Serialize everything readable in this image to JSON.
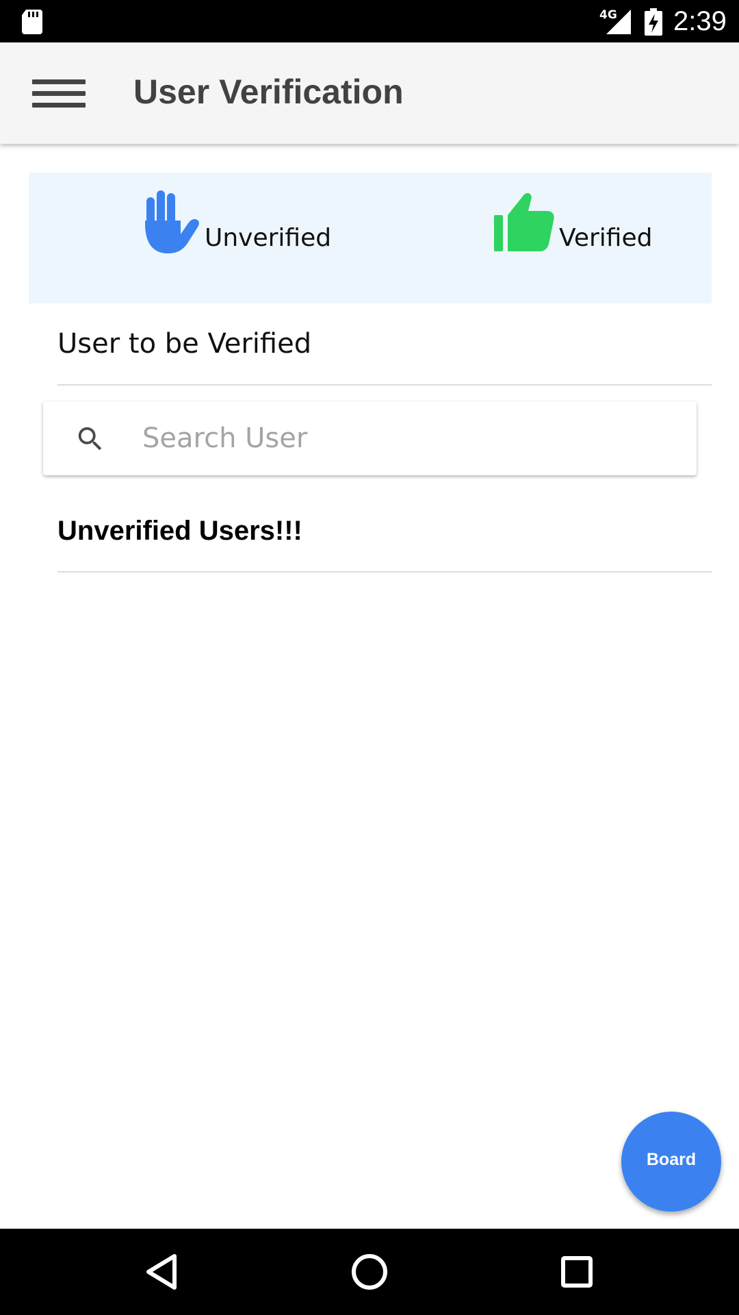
{
  "status_bar": {
    "network": "4G",
    "time": "2:39",
    "icons": [
      "sd-card-icon",
      "signal-icon",
      "battery-charging-icon"
    ]
  },
  "app_bar": {
    "title": "User Verification",
    "menu_icon": "hamburger-menu-icon"
  },
  "tabs": [
    {
      "label": "Unverified",
      "icon": "hand-icon",
      "color": "#3b82f0"
    },
    {
      "label": "Verified",
      "icon": "thumbs-up-icon",
      "color": "#2ed360"
    }
  ],
  "main": {
    "section_title": "User to be Verified",
    "search": {
      "placeholder": "Search User",
      "value": "",
      "icon": "search-icon"
    },
    "list_title": "Unverified Users!!!"
  },
  "fab": {
    "label": "Board",
    "color": "#3b82f0"
  },
  "nav_bar": {
    "icons": [
      "back-icon",
      "home-icon",
      "recents-icon"
    ]
  }
}
